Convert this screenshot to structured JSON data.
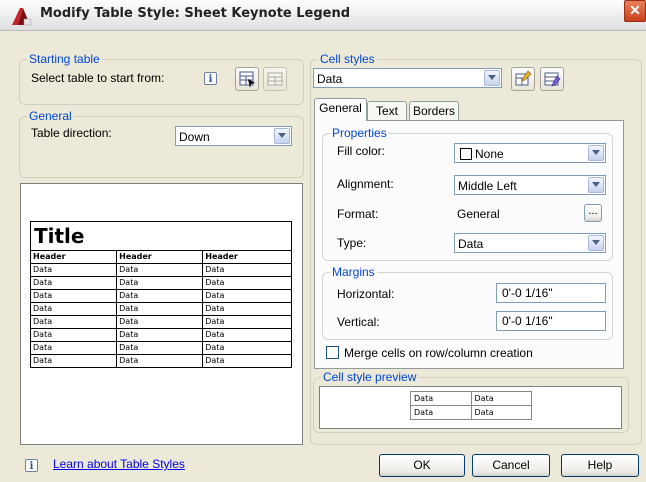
{
  "window": {
    "title": "Modify Table Style: Sheet Keynote Legend",
    "close": "✕"
  },
  "starting_table": {
    "legend": "Starting table",
    "label": "Select table to start from:",
    "info": "i"
  },
  "general_group": {
    "legend": "General",
    "direction_label": "Table direction:",
    "direction_value": "Down"
  },
  "table_preview": {
    "title": "Title",
    "headers": [
      "Header",
      "Header",
      "Header"
    ],
    "rows": [
      [
        "Data",
        "Data",
        "Data"
      ],
      [
        "Data",
        "Data",
        "Data"
      ],
      [
        "Data",
        "Data",
        "Data"
      ],
      [
        "Data",
        "Data",
        "Data"
      ],
      [
        "Data",
        "Data",
        "Data"
      ],
      [
        "Data",
        "Data",
        "Data"
      ],
      [
        "Data",
        "Data",
        "Data"
      ],
      [
        "Data",
        "Data",
        "Data"
      ]
    ]
  },
  "cell_styles": {
    "legend": "Cell styles",
    "selected": "Data",
    "tabs": [
      {
        "label": "General"
      },
      {
        "label": "Text"
      },
      {
        "label": "Borders"
      }
    ],
    "properties": {
      "legend": "Properties",
      "fill_label": "Fill color:",
      "fill_value": "None",
      "align_label": "Alignment:",
      "align_value": "Middle Left",
      "format_label": "Format:",
      "format_value": "General",
      "format_btn": "...",
      "type_label": "Type:",
      "type_value": "Data"
    },
    "margins": {
      "legend": "Margins",
      "horizontal_label": "Horizontal:",
      "horizontal_value": "0'-0 1/16\"",
      "vertical_label": "Vertical:",
      "vertical_value": "0'-0 1/16\""
    },
    "merge_label": "Merge cells on row/column creation",
    "preview": {
      "legend": "Cell style preview",
      "cells": [
        [
          "Data",
          "Data"
        ],
        [
          "Data",
          "Data"
        ]
      ]
    }
  },
  "footer": {
    "info": "i",
    "link": "Learn about Table Styles",
    "ok": "OK",
    "cancel": "Cancel",
    "help": "Help"
  },
  "colors": {
    "group_legend": "#0046d5",
    "dialog_bg": "#ece9d8",
    "close": "#c8401e"
  }
}
